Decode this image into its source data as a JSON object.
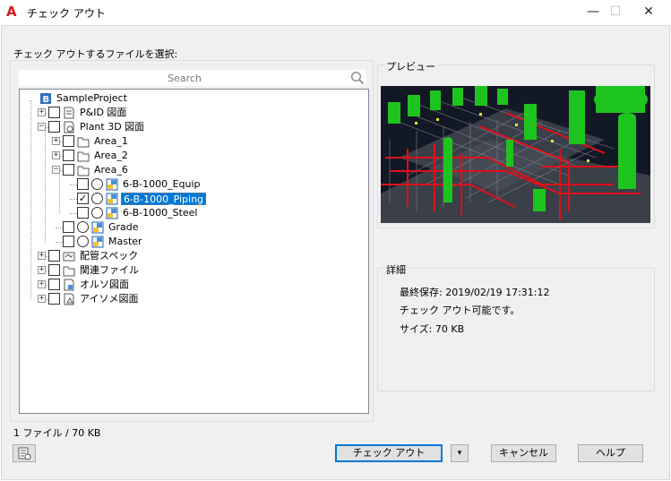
{
  "window": {
    "title": "チェック アウト",
    "app_icon": "A",
    "minimize": "—",
    "maximize": "☐",
    "close": "✕"
  },
  "left": {
    "select_label": "チェック アウトするファイルを選択:",
    "search_placeholder": "Search",
    "search_value": "",
    "tree": [
      {
        "label": "SampleProject",
        "icon": "project-icon"
      },
      {
        "label": "P&ID 図面",
        "icon": "pid-folder-icon"
      },
      {
        "label": "Plant 3D 図面",
        "icon": "plant3d-folder-icon"
      },
      {
        "label": "Area_1",
        "icon": "folder-icon"
      },
      {
        "label": "Area_2",
        "icon": "folder-icon"
      },
      {
        "label": "Area_6",
        "icon": "folder-icon"
      },
      {
        "label": "6-B-1000_Equip",
        "icon": "drawing-icon"
      },
      {
        "label": "6-B-1000_Piping",
        "icon": "drawing-icon",
        "checked": true,
        "selected": true
      },
      {
        "label": "6-B-1000_Steel",
        "icon": "drawing-icon"
      },
      {
        "label": "Grade",
        "icon": "drawing-icon"
      },
      {
        "label": "Master",
        "icon": "drawing-icon"
      },
      {
        "label": "配管スペック",
        "icon": "spec-folder-icon"
      },
      {
        "label": "関連ファイル",
        "icon": "folder-icon"
      },
      {
        "label": "オルソ図面",
        "icon": "ortho-folder-icon"
      },
      {
        "label": "アイソメ図面",
        "icon": "iso-folder-icon"
      }
    ],
    "status": "1 ファイル / 70 KB"
  },
  "preview": {
    "label": "プレビュー"
  },
  "details": {
    "label": "詳細",
    "last_saved": "最終保存: 2019/02/19 17:31:12",
    "availability": "チェック アウト可能です。",
    "size": "サイズ: 70 KB"
  },
  "buttons": {
    "checkout": "チェック アウト",
    "dropdown": "▾",
    "cancel": "キャンセル",
    "help": "ヘルプ"
  }
}
